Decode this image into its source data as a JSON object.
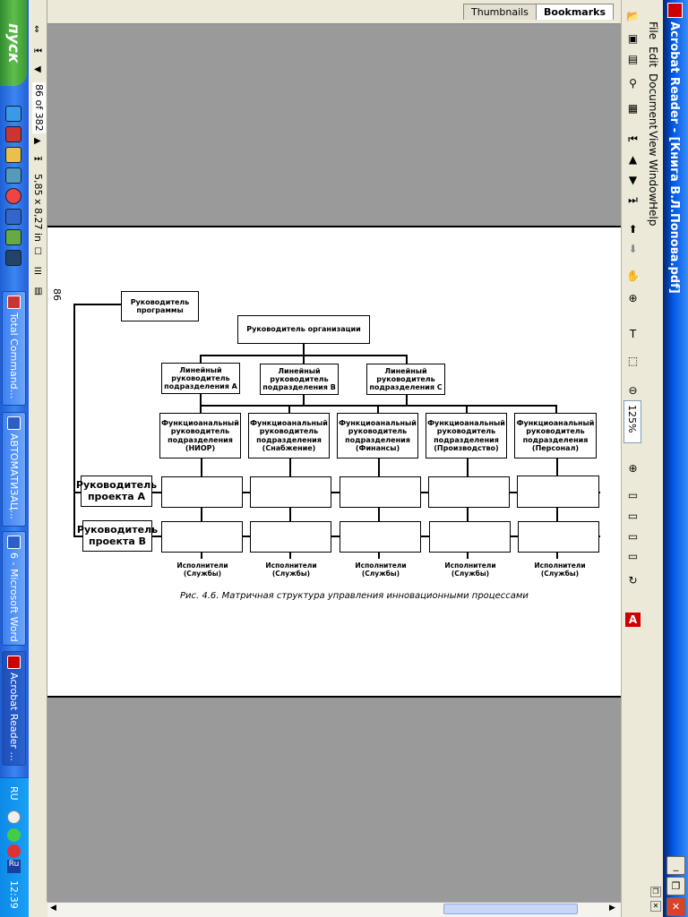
{
  "taskbar": {
    "start_label": "пуск",
    "tasks": [
      {
        "label": "Total Command..."
      },
      {
        "label": "АВТОМАТИЗАЦ..."
      },
      {
        "label": "6 - Microsoft Word"
      },
      {
        "label": "Acrobat Reader ..."
      }
    ],
    "tray": {
      "lang": "RU",
      "lang2": "Ru",
      "clock": "12:39"
    }
  },
  "window": {
    "title": "Acrobat Reader - [Книга В.Л.Попова.pdf]",
    "menu": [
      "File",
      "Edit",
      "Document",
      "View",
      "Window",
      "Help"
    ]
  },
  "tabs": {
    "thumbnails": "Thumbnails",
    "bookmarks": "Bookmarks"
  },
  "status": {
    "page": "86 of 382",
    "size": "5,85 x 8,27 in",
    "zoom": "125%"
  },
  "document": {
    "page_number": "86",
    "program_head": "Руководитель программы",
    "org_head": "Руководитель организации",
    "line_heads": [
      "Линейный руководитель подразделения А",
      "Линейный руководитель подразделения В",
      "Линейный руководитель подразделения С"
    ],
    "func_heads": [
      "Функциоанальный руководитель подразделения (НИОР)",
      "Функциоанальный руководитель подразделения (Снабжение)",
      "Функциоанальный руководитель подразделения (Финансы)",
      "Функциоанальный руководитель подразделения (Производство)",
      "Функциоанальный руководитель подразделения (Персонал)"
    ],
    "project_a": "Руководитель проекта А",
    "project_b": "Руководитель проекта В",
    "performers": "Исполнители (Службы)",
    "caption": "Рис. 4.6. Матричная структура управления инновационными процессами"
  }
}
